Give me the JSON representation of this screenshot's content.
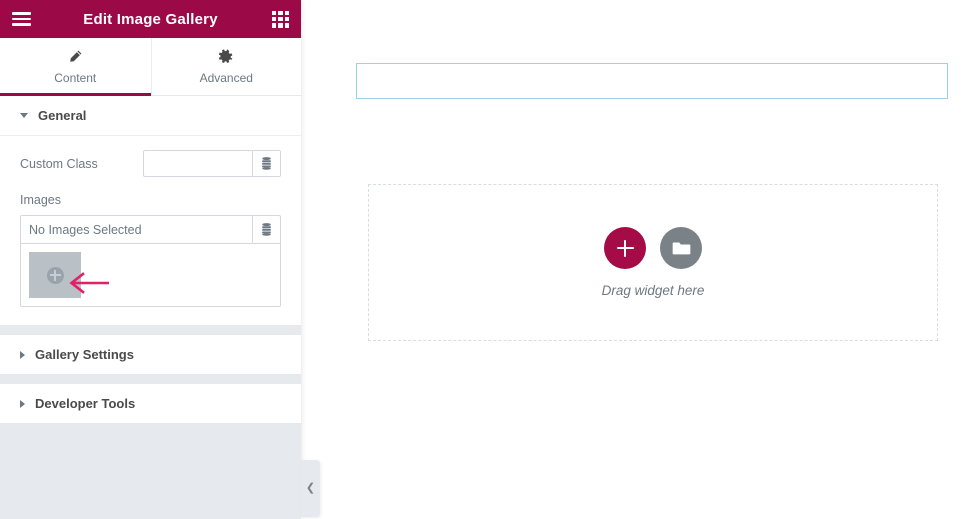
{
  "panel": {
    "header": {
      "title": "Edit Image Gallery",
      "menu_icon": "hamburger-icon",
      "grid_icon": "app-grid-icon",
      "background_color": "#9b0a46"
    },
    "tabs": [
      {
        "label": "Content",
        "icon": "pencil-icon",
        "active": true
      },
      {
        "label": "Advanced",
        "icon": "gear-icon",
        "active": false
      }
    ],
    "sections": [
      {
        "title": "General",
        "expanded": true,
        "fields": {
          "custom_class": {
            "label": "Custom Class",
            "value": "",
            "placeholder": "",
            "addon_icon": "dynamic-tags-icon"
          },
          "images": {
            "label": "Images",
            "value": "No Images Selected",
            "addon_icon": "dynamic-tags-icon",
            "thumbnails": [
              {
                "name": "image-placeholder",
                "alt": ""
              }
            ]
          }
        }
      },
      {
        "title": "Gallery Settings",
        "expanded": false
      },
      {
        "title": "Developer Tools",
        "expanded": false
      }
    ],
    "collapse_handle_icon": "chevron-left-icon"
  },
  "canvas": {
    "selected_section": {
      "name": "empty-section",
      "border_color": "#9ad3e3"
    },
    "dropzone": {
      "text": "Drag widget here",
      "add_button": {
        "icon": "plus-icon",
        "color": "#a50b46"
      },
      "folder_button": {
        "icon": "folder-icon",
        "color": "#7a8288"
      }
    }
  },
  "annotation": {
    "arrow": {
      "name": "annotation-arrow",
      "color": "#e0216a",
      "points_to": "image-placeholder-thumbnail"
    }
  }
}
